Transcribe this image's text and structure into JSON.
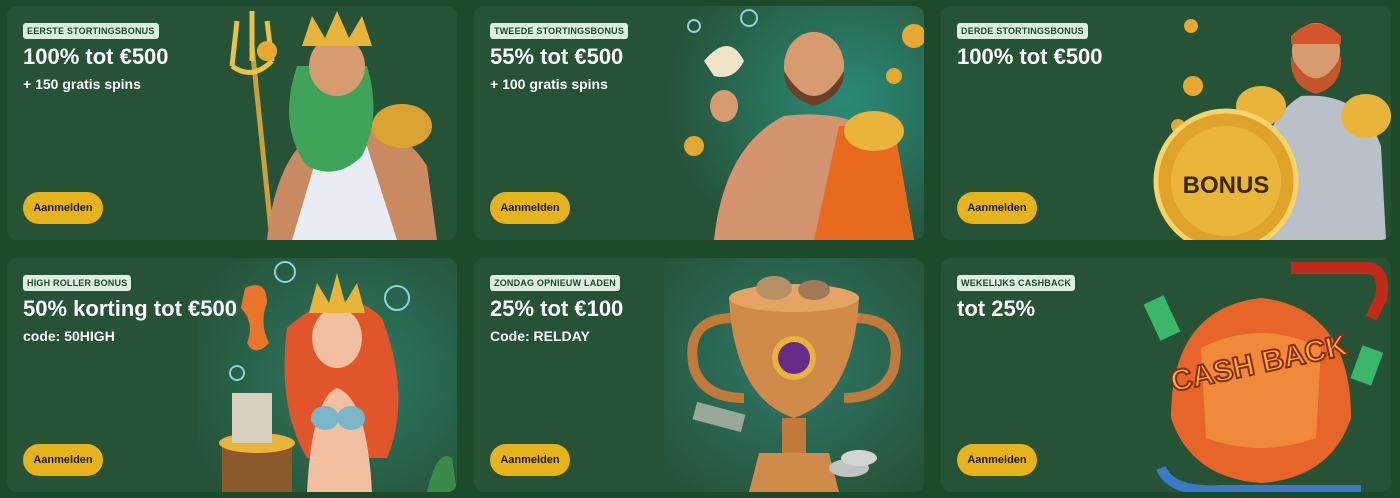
{
  "colors": {
    "page_bg": "#1e4a2c",
    "card_bg": "#265236",
    "badge_bg": "#dcefdc",
    "button_bg": "#e6b31a",
    "text": "#ffffff"
  },
  "cards": [
    {
      "badge": "EERSTE STORTINGSBONUS",
      "title": "100% tot €500",
      "subtitle": "+ 150 gratis spins",
      "button": "Aanmelden",
      "art": "poseidon-illustration"
    },
    {
      "badge": "TWEEDE STORTINGSBONUS",
      "title": "55% tot €500",
      "subtitle": "+ 100 gratis spins",
      "button": "Aanmelden",
      "art": "greek-god-with-shell-illustration"
    },
    {
      "badge": "DERDE STORTINGSBONUS",
      "title": "100% tot €500",
      "subtitle": "",
      "button": "Aanmelden",
      "art": "warrior-with-bonus-shield-illustration",
      "art_text": "BONUS"
    },
    {
      "badge": "HIGH ROLLER BONUS",
      "title": "50% korting tot €500",
      "subtitle": "code: 50HIGH",
      "button": "Aanmelden",
      "art": "mermaid-with-treasure-illustration"
    },
    {
      "badge": "ZONDAG OPNIEUW LADEN",
      "title": "25% tot €100",
      "subtitle": "Code: RELDAY",
      "button": "Aanmelden",
      "art": "trophy-cup-illustration"
    },
    {
      "badge": "WEKELIJKS CASHBACK",
      "title": "tot 25%",
      "subtitle": "",
      "button": "Aanmelden",
      "art": "cashback-shell-illustration",
      "art_text": "CASH BACK"
    }
  ]
}
